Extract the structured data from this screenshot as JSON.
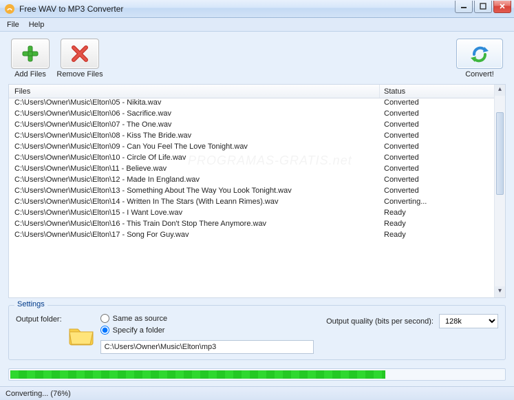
{
  "window": {
    "title": "Free WAV to MP3 Converter"
  },
  "menu": {
    "file": "File",
    "help": "Help"
  },
  "toolbar": {
    "add_label": "Add Files",
    "remove_label": "Remove Files",
    "convert_label": "Convert!"
  },
  "list": {
    "header_files": "Files",
    "header_status": "Status",
    "rows": [
      {
        "file": "C:\\Users\\Owner\\Music\\Elton\\05 - Nikita.wav",
        "status": "Converted"
      },
      {
        "file": "C:\\Users\\Owner\\Music\\Elton\\06 - Sacrifice.wav",
        "status": "Converted"
      },
      {
        "file": "C:\\Users\\Owner\\Music\\Elton\\07 - The One.wav",
        "status": "Converted"
      },
      {
        "file": "C:\\Users\\Owner\\Music\\Elton\\08 - Kiss The Bride.wav",
        "status": "Converted"
      },
      {
        "file": "C:\\Users\\Owner\\Music\\Elton\\09 - Can You Feel The Love Tonight.wav",
        "status": "Converted"
      },
      {
        "file": "C:\\Users\\Owner\\Music\\Elton\\10 - Circle Of Life.wav",
        "status": "Converted"
      },
      {
        "file": "C:\\Users\\Owner\\Music\\Elton\\11 - Believe.wav",
        "status": "Converted"
      },
      {
        "file": "C:\\Users\\Owner\\Music\\Elton\\12 - Made In England.wav",
        "status": "Converted"
      },
      {
        "file": "C:\\Users\\Owner\\Music\\Elton\\13 - Something About The Way You Look Tonight.wav",
        "status": "Converted"
      },
      {
        "file": "C:\\Users\\Owner\\Music\\Elton\\14 - Written In The Stars (With Leann Rimes).wav",
        "status": "Converting..."
      },
      {
        "file": "C:\\Users\\Owner\\Music\\Elton\\15 - I Want Love.wav",
        "status": "Ready"
      },
      {
        "file": "C:\\Users\\Owner\\Music\\Elton\\16 - This Train Don't Stop There Anymore.wav",
        "status": "Ready"
      },
      {
        "file": "C:\\Users\\Owner\\Music\\Elton\\17 - Song For Guy.wav",
        "status": "Ready"
      }
    ]
  },
  "settings": {
    "legend": "Settings",
    "output_folder_label": "Output folder:",
    "same_as_source": "Same as source",
    "specify_folder": "Specify a folder",
    "selected": "specify",
    "path_value": "C:\\Users\\Owner\\Music\\Elton\\mp3",
    "quality_label": "Output quality (bits per second):",
    "quality_value": "128k"
  },
  "progress": {
    "percent": 76
  },
  "statusbar": {
    "text": "Converting... (76%)"
  }
}
